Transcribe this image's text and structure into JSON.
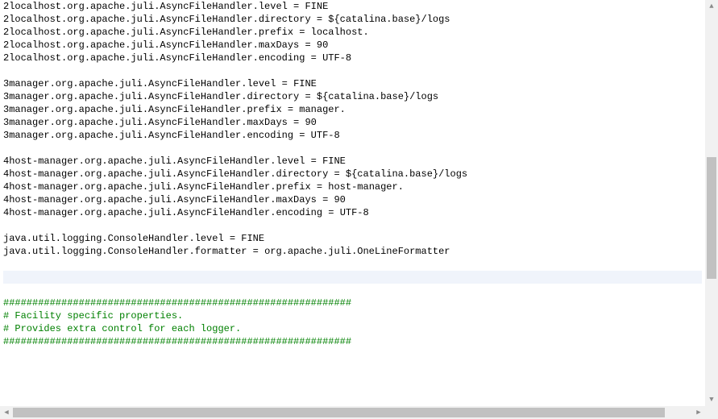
{
  "code": {
    "lines": [
      {
        "type": "prop",
        "key": "2localhost.org.apache.juli.AsyncFileHandler.level",
        "op": " = ",
        "val": "FINE"
      },
      {
        "type": "prop",
        "key": "2localhost.org.apache.juli.AsyncFileHandler.directory",
        "op": " = ",
        "val": "${catalina.base}/logs"
      },
      {
        "type": "prop",
        "key": "2localhost.org.apache.juli.AsyncFileHandler.prefix",
        "op": " = ",
        "val": "localhost."
      },
      {
        "type": "prop",
        "key": "2localhost.org.apache.juli.AsyncFileHandler.maxDays",
        "op": " = ",
        "val": "90"
      },
      {
        "type": "prop",
        "key": "2localhost.org.apache.juli.AsyncFileHandler.encoding",
        "op": " = ",
        "val": "UTF-8"
      },
      {
        "type": "blank"
      },
      {
        "type": "prop",
        "key": "3manager.org.apache.juli.AsyncFileHandler.level",
        "op": " = ",
        "val": "FINE"
      },
      {
        "type": "prop",
        "key": "3manager.org.apache.juli.AsyncFileHandler.directory",
        "op": " = ",
        "val": "${catalina.base}/logs"
      },
      {
        "type": "prop",
        "key": "3manager.org.apache.juli.AsyncFileHandler.prefix",
        "op": " = ",
        "val": "manager."
      },
      {
        "type": "prop",
        "key": "3manager.org.apache.juli.AsyncFileHandler.maxDays",
        "op": " = ",
        "val": "90"
      },
      {
        "type": "prop",
        "key": "3manager.org.apache.juli.AsyncFileHandler.encoding",
        "op": " = ",
        "val": "UTF-8"
      },
      {
        "type": "blank"
      },
      {
        "type": "prop",
        "key": "4host-manager.org.apache.juli.AsyncFileHandler.level",
        "op": " = ",
        "val": "FINE"
      },
      {
        "type": "prop",
        "key": "4host-manager.org.apache.juli.AsyncFileHandler.directory",
        "op": " = ",
        "val": "${catalina.base}/logs"
      },
      {
        "type": "prop",
        "key": "4host-manager.org.apache.juli.AsyncFileHandler.prefix",
        "op": " = ",
        "val": "host-manager."
      },
      {
        "type": "prop",
        "key": "4host-manager.org.apache.juli.AsyncFileHandler.maxDays",
        "op": " = ",
        "val": "90"
      },
      {
        "type": "prop",
        "key": "4host-manager.org.apache.juli.AsyncFileHandler.encoding",
        "op": " = ",
        "val": "UTF-8"
      },
      {
        "type": "blank"
      },
      {
        "type": "prop",
        "key": "java.util.logging.ConsoleHandler.level",
        "op": " = ",
        "val": "FINE"
      },
      {
        "type": "prop",
        "key": "java.util.logging.ConsoleHandler.formatter",
        "op": " = ",
        "val": "org.apache.juli.OneLineFormatter"
      },
      {
        "type": "blank"
      },
      {
        "type": "blank",
        "highlight": true
      },
      {
        "type": "blank"
      },
      {
        "type": "comment",
        "text": "############################################################"
      },
      {
        "type": "comment",
        "text": "# Facility specific properties."
      },
      {
        "type": "comment",
        "text": "# Provides extra control for each logger."
      },
      {
        "type": "comment",
        "text": "############################################################"
      },
      {
        "type": "blank"
      }
    ]
  },
  "scrollbar": {
    "v": {
      "thumb_top_pct": 38,
      "thumb_height_pct": 32
    },
    "h": {
      "thumb_left_pct": 0,
      "thumb_width_pct": 96
    }
  },
  "glyphs": {
    "arrow_up": "▲",
    "arrow_down": "▼",
    "arrow_left": "◀",
    "arrow_right": "▶"
  }
}
